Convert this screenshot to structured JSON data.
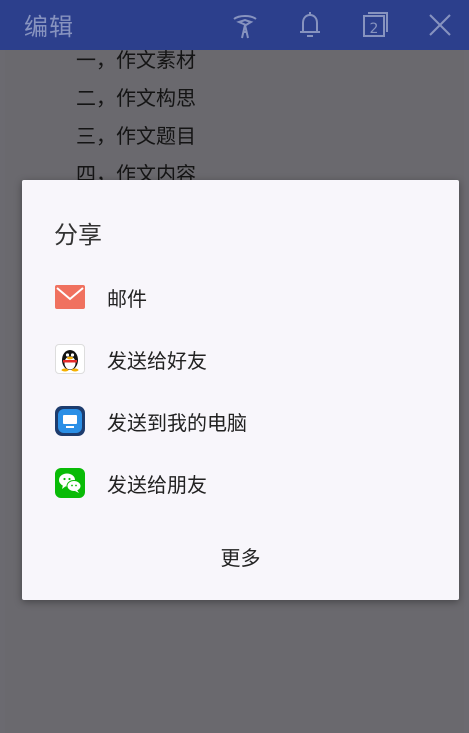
{
  "appbar": {
    "title": "编辑",
    "actions": [
      "broadcast-icon",
      "bell-icon",
      "tabs-icon",
      "close-icon"
    ],
    "tab_count": "2"
  },
  "document": {
    "lines": [
      "一，作文素材",
      "二，作文构思",
      "三，作文题目",
      "四，作文内容"
    ]
  },
  "dialog": {
    "title": "分享",
    "options": [
      {
        "label": "邮件",
        "icon": "mail-icon"
      },
      {
        "label": "发送给好友",
        "icon": "qq-icon"
      },
      {
        "label": "发送到我的电脑",
        "icon": "computer-icon"
      },
      {
        "label": "发送给朋友",
        "icon": "wechat-icon"
      }
    ],
    "more_label": "更多"
  },
  "colors": {
    "appbar": "#2c3f8c",
    "dialog_bg": "#f8f6fb",
    "mail": "#f0715f",
    "wechat": "#09bb07",
    "computer": "#2a8fe6"
  }
}
